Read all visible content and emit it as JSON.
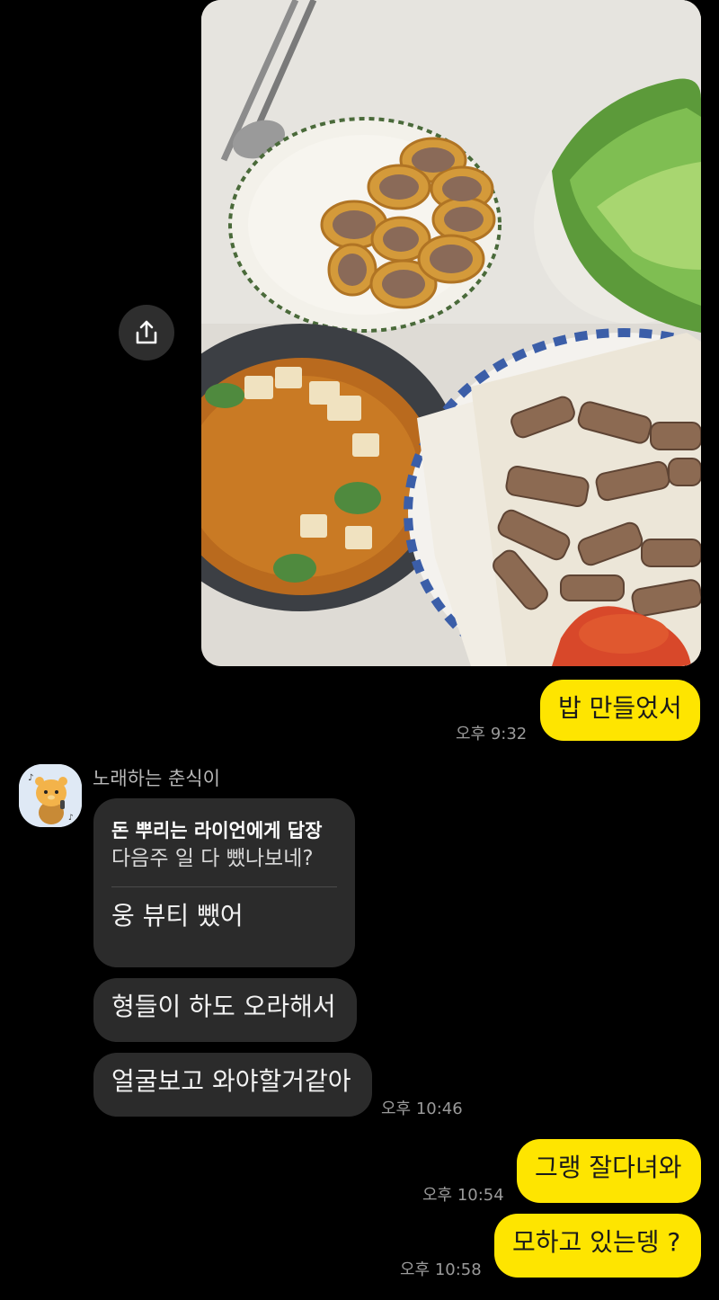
{
  "chat": {
    "photo_alt": "food photo",
    "sent_1": {
      "text": "밥 만들었서",
      "time": "오후 9:32"
    },
    "incoming": {
      "sender": "노래하는 춘식이",
      "reply": {
        "title": "돈 뿌리는 라이언에게 답장",
        "quote": "다음주 일 다 뺐나보네?",
        "text": "웅 뷰티 뺐어"
      },
      "messages": [
        "형들이 하도 오라해서",
        "얼굴보고 와야할거같아"
      ],
      "time": "오후 10:46"
    },
    "sent_2": {
      "text": "그랭 잘다녀와",
      "time": "오후 10:54"
    },
    "sent_3": {
      "text": "모하고 있는뎅 ?",
      "time": "오후 10:58"
    }
  },
  "icons": {
    "share": "share-icon",
    "avatar": "chunsik-avatar-icon"
  },
  "colors": {
    "background": "#000000",
    "my_bubble": "#fee500",
    "their_bubble": "#2b2b2b",
    "time_text": "#9a9a9a"
  }
}
